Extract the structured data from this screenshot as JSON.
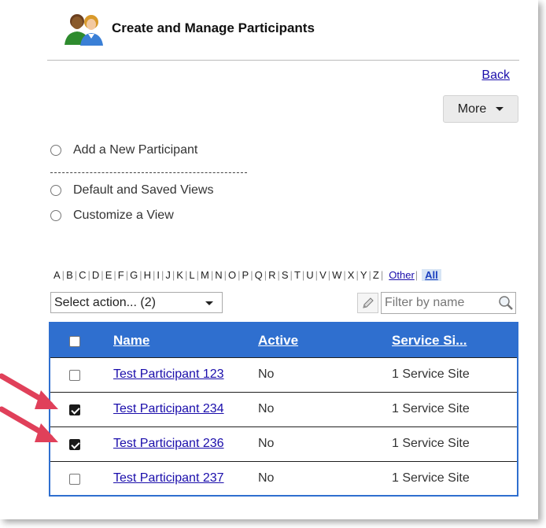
{
  "header": {
    "title": "Create and Manage Participants"
  },
  "nav": {
    "back_label": "Back",
    "more_label": "More"
  },
  "options": [
    {
      "label": "Add a New Participant"
    },
    {
      "label": "Default and Saved Views"
    },
    {
      "label": "Customize a View"
    }
  ],
  "alpha_filter": {
    "letters": [
      "A",
      "B",
      "C",
      "D",
      "E",
      "F",
      "G",
      "H",
      "I",
      "J",
      "K",
      "L",
      "M",
      "N",
      "O",
      "P",
      "Q",
      "R",
      "S",
      "T",
      "U",
      "V",
      "W",
      "X",
      "Y",
      "Z"
    ],
    "other_label": "Other",
    "all_label": "All"
  },
  "actions": {
    "select_label": "Select action... (2)"
  },
  "filter": {
    "placeholder": "Filter by name"
  },
  "table": {
    "columns": [
      "Name",
      "Active",
      "Service Si..."
    ],
    "rows": [
      {
        "name": "Test Participant 123",
        "active": "No",
        "site": "1 Service Site",
        "checked": false
      },
      {
        "name": "Test Participant 234",
        "active": "No",
        "site": "1 Service Site",
        "checked": true
      },
      {
        "name": "Test Participant 236",
        "active": "No",
        "site": "1 Service Site",
        "checked": true
      },
      {
        "name": "Test Participant 237",
        "active": "No",
        "site": "1 Service Site",
        "checked": false
      }
    ]
  },
  "colors": {
    "header_blue": "#2f6fcf",
    "link": "#1a0dab",
    "arrow": "#e0405a"
  }
}
